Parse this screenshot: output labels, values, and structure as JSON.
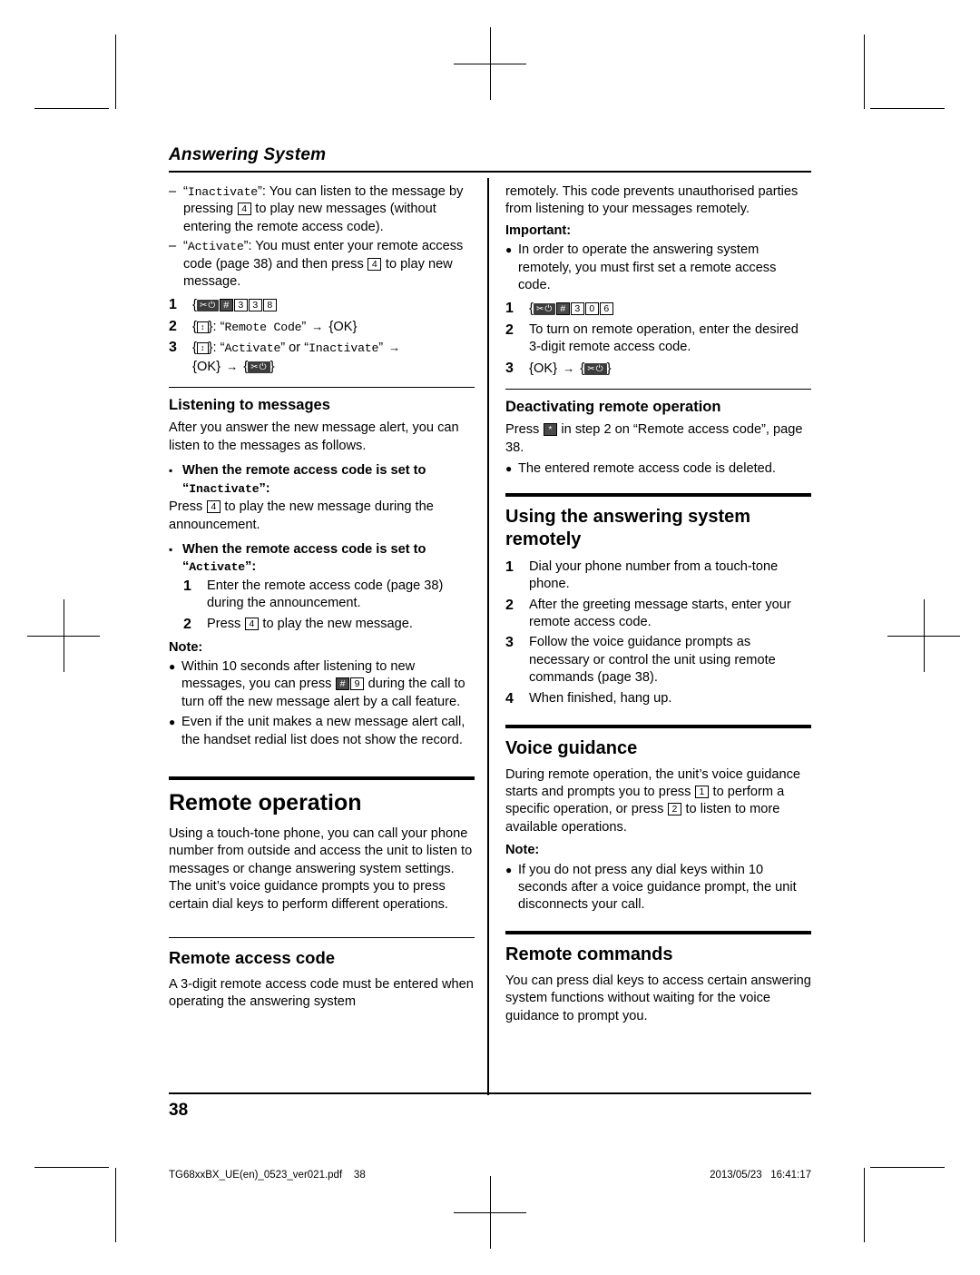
{
  "document": {
    "chapter_title": "Answering System",
    "page_number": "38",
    "footer_left": "TG68xxBX_UE(en)_0523_ver021.pdf    38",
    "footer_right": "2013/05/23   16:41:17"
  },
  "left_column": {
    "dash_items": [
      {
        "quoted": "Inactivate",
        "text_1": "”: You can listen to the message by pressing ",
        "key": "4",
        "text_2": " to play new messages (without entering the remote access code)."
      },
      {
        "quoted": "Activate",
        "text_1": "”: You must enter your remote access code (page 38) and then press ",
        "key": "4",
        "text_2": " to play new message."
      }
    ],
    "steps": [
      {
        "num": "1",
        "text": ""
      },
      {
        "num": "2",
        "text": "Remote Code"
      },
      {
        "num": "3",
        "text_a": "Activate",
        "text_or": " or ",
        "text_b": "Inactivate"
      }
    ],
    "step2_ok": "OK",
    "step3_ok": "OK",
    "listening_heading": "Listening to messages",
    "listening_intro": "After you answer the new message alert, you can listen to the messages as follows.",
    "square_1_head": "When the remote access code is set to",
    "square_1_quoted": "Inactivate",
    "square_1_body_pre": "Press ",
    "square_1_key": "4",
    "square_1_body_post": " to play the new message during the announcement.",
    "square_2_head": "When the remote access code is set to",
    "square_2_quoted": "Activate",
    "square_2_steps": [
      {
        "num": "1",
        "text": "Enter the remote access code (page 38) during the announcement."
      },
      {
        "num": "2",
        "text_pre": "Press ",
        "key": "4",
        "text_post": " to play the new message."
      }
    ],
    "note_label": "Note:",
    "notes": [
      {
        "pre": "Within 10 seconds after listening to new messages, you can press ",
        "keys": "#9",
        "post": " during the call to turn off the new message alert by a call feature."
      },
      {
        "pre": "Even if the unit makes a new message alert call, the handset redial list does not show the record.",
        "keys": "",
        "post": ""
      }
    ],
    "remote_operation_heading": "Remote operation",
    "remote_operation_body": "Using a touch-tone phone, you can call your phone number from outside and access the unit to listen to messages or change answering system settings. The unit’s voice guidance prompts you to press certain dial keys to perform different operations.",
    "remote_access_code_heading": "Remote access code",
    "remote_access_code_body": "A 3-digit remote access code must be entered when operating the answering system"
  },
  "right_column": {
    "continuation": "remotely. This code prevents unauthorised parties from listening to your messages remotely.",
    "important_label": "Important:",
    "important_bullet": "In order to operate the answering system remotely, you must first set a remote access code.",
    "steps": [
      {
        "num": "1",
        "text": ""
      },
      {
        "num": "2",
        "text": "To turn on remote operation, enter the desired 3-digit remote access code."
      },
      {
        "num": "3",
        "text": ""
      }
    ],
    "step3_ok": "OK",
    "deactivating_heading": "Deactivating remote operation",
    "deactivating_body_pre": "Press ",
    "deactivating_key": "*",
    "deactivating_body_post": " in step 2 on “Remote access code”, page 38.",
    "deactivating_bullet": "The entered remote access code is deleted.",
    "using_heading": "Using the answering system remotely",
    "using_steps": [
      {
        "num": "1",
        "text": "Dial your phone number from a touch-tone phone."
      },
      {
        "num": "2",
        "text": "After the greeting message starts, enter your remote access code."
      },
      {
        "num": "3",
        "text": "Follow the voice guidance prompts as necessary or control the unit using remote commands (page 38)."
      },
      {
        "num": "4",
        "text": "When finished, hang up."
      }
    ],
    "voice_guidance_heading": "Voice guidance",
    "voice_guidance_body_pre": "During remote operation, the unit’s voice guidance starts and prompts you to press ",
    "voice_guidance_key1": "1",
    "voice_guidance_body_mid": " to perform a specific operation, or press ",
    "voice_guidance_key2": "2",
    "voice_guidance_body_post": " to listen to more available operations.",
    "note_label": "Note:",
    "note_bullet": "If you do not press any dial keys within 10 seconds after a voice guidance prompt, the unit disconnects your call.",
    "remote_commands_heading": "Remote commands",
    "remote_commands_body": "You can press dial keys to access certain answering system functions without waiting for the voice guidance to prompt you."
  },
  "key_codes": {
    "star": "*",
    "hash": "#",
    "d3": "3",
    "d8": "8",
    "d0": "0",
    "d6": "6",
    "d4": "4",
    "d9": "9",
    "d1": "1",
    "d2": "2",
    "ok": "OK",
    "nav": "↕",
    "phone_power": "✂⏻"
  }
}
